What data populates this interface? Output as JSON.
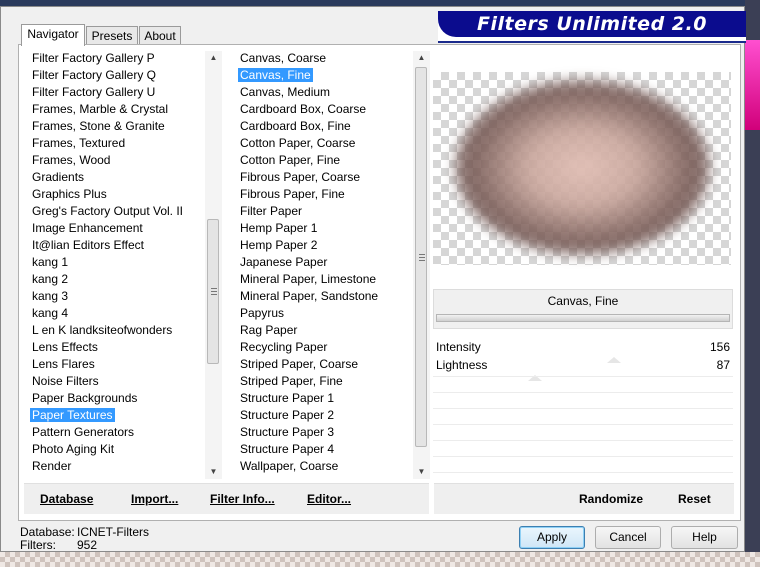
{
  "window": {
    "title": "Filters Unlimited 2.0"
  },
  "tabs": [
    {
      "label": "Navigator"
    },
    {
      "label": "Presets"
    },
    {
      "label": "About"
    }
  ],
  "categories": {
    "items": [
      "Filter Factory Gallery P",
      "Filter Factory Gallery Q",
      "Filter Factory Gallery U",
      "Frames, Marble & Crystal",
      "Frames, Stone & Granite",
      "Frames, Textured",
      "Frames, Wood",
      "Gradients",
      "Graphics Plus",
      "Greg's Factory Output Vol. II",
      "Image Enhancement",
      "It@lian Editors Effect",
      "kang 1",
      "kang 2",
      "kang 3",
      "kang 4",
      "L en K landksiteofwonders",
      "Lens Effects",
      "Lens Flares",
      "Noise Filters",
      "Paper Backgrounds",
      "Paper Textures",
      "Pattern Generators",
      "Photo Aging Kit",
      "Render"
    ],
    "selected": "Paper Textures"
  },
  "filters": {
    "items": [
      "Canvas, Coarse",
      "Canvas, Fine",
      "Canvas, Medium",
      "Cardboard Box, Coarse",
      "Cardboard Box, Fine",
      "Cotton Paper, Coarse",
      "Cotton Paper, Fine",
      "Fibrous Paper, Coarse",
      "Fibrous Paper, Fine",
      "Filter Paper",
      "Hemp Paper 1",
      "Hemp Paper 2",
      "Japanese Paper",
      "Mineral Paper, Limestone",
      "Mineral Paper, Sandstone",
      "Papyrus",
      "Rag Paper",
      "Recycling Paper",
      "Striped Paper, Coarse",
      "Striped Paper, Fine",
      "Structure Paper 1",
      "Structure Paper 2",
      "Structure Paper 3",
      "Structure Paper 4",
      "Wallpaper, Coarse"
    ],
    "selected": "Canvas, Fine"
  },
  "left_buttons": {
    "database": "Database",
    "import": "Import...",
    "filter_info": "Filter Info...",
    "editor": "Editor..."
  },
  "preview": {
    "filter_name": "Canvas, Fine"
  },
  "params": [
    {
      "name": "Intensity",
      "value": "156"
    },
    {
      "name": "Lightness",
      "value": "87"
    }
  ],
  "right_buttons": {
    "randomize": "Randomize",
    "reset": "Reset"
  },
  "status": {
    "database_label": "Database:",
    "database_value": "ICNET-Filters",
    "filters_label": "Filters:",
    "filters_value": "952"
  },
  "dialog_buttons": {
    "apply": "Apply",
    "cancel": "Cancel",
    "help": "Help"
  },
  "colors": {
    "selection": "#3399ff",
    "title_banner": "#0b0c8e"
  }
}
